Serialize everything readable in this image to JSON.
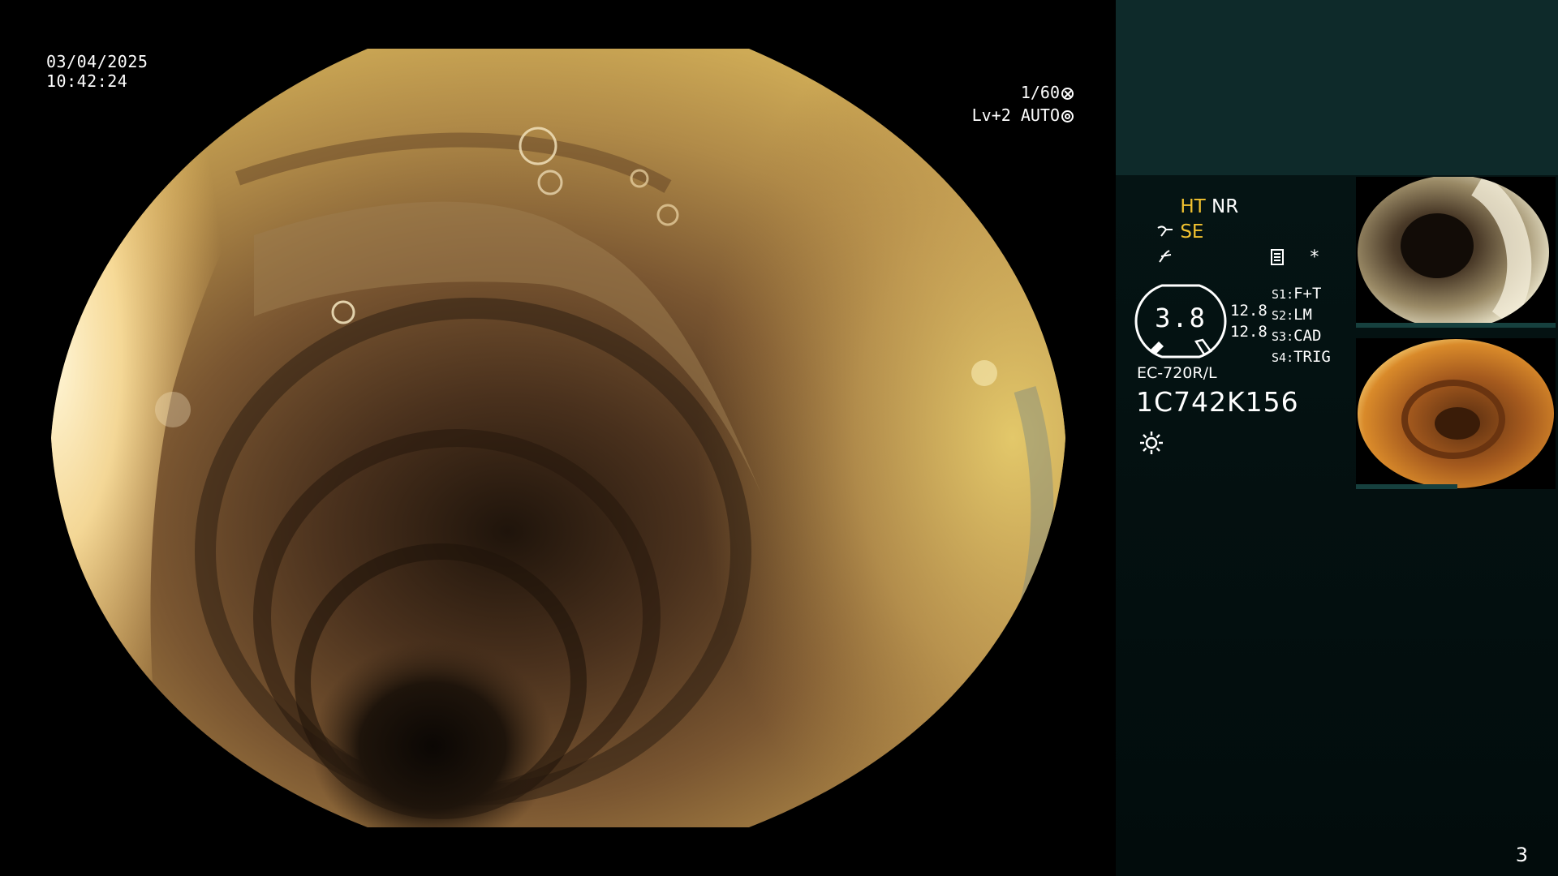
{
  "overlay": {
    "date": "03/04/2025",
    "time": "10:42:24",
    "shutter": "1/60",
    "enhancement": "Lv+2 AUTO",
    "shutter_icon": "shutter-icon",
    "iris_icon": "auto-iris-icon"
  },
  "status": {
    "ht": "HT",
    "nr": "NR",
    "se": "SE",
    "se_icon": "enhancement-icon",
    "freeze_icon": "freeze-icon",
    "menu_icon": "menu-icon",
    "star": "*"
  },
  "gauge": {
    "value": "3.8",
    "sub_top": "12.8",
    "sub_bottom": "12.8"
  },
  "switches": [
    {
      "key": "S1",
      "value": "F+T"
    },
    {
      "key": "S2",
      "value": "LM"
    },
    {
      "key": "S3",
      "value": "CAD"
    },
    {
      "key": "S4",
      "value": "TRIG"
    }
  ],
  "scope": {
    "model": "EC-720R/L",
    "serial": "1C742K156",
    "light_icon": "light-source-icon"
  },
  "page": {
    "number": "3"
  },
  "colors": {
    "accent_yellow": "#f2c230",
    "panel_top": "#0e2a2a",
    "panel_bottom": "#020c0c"
  }
}
